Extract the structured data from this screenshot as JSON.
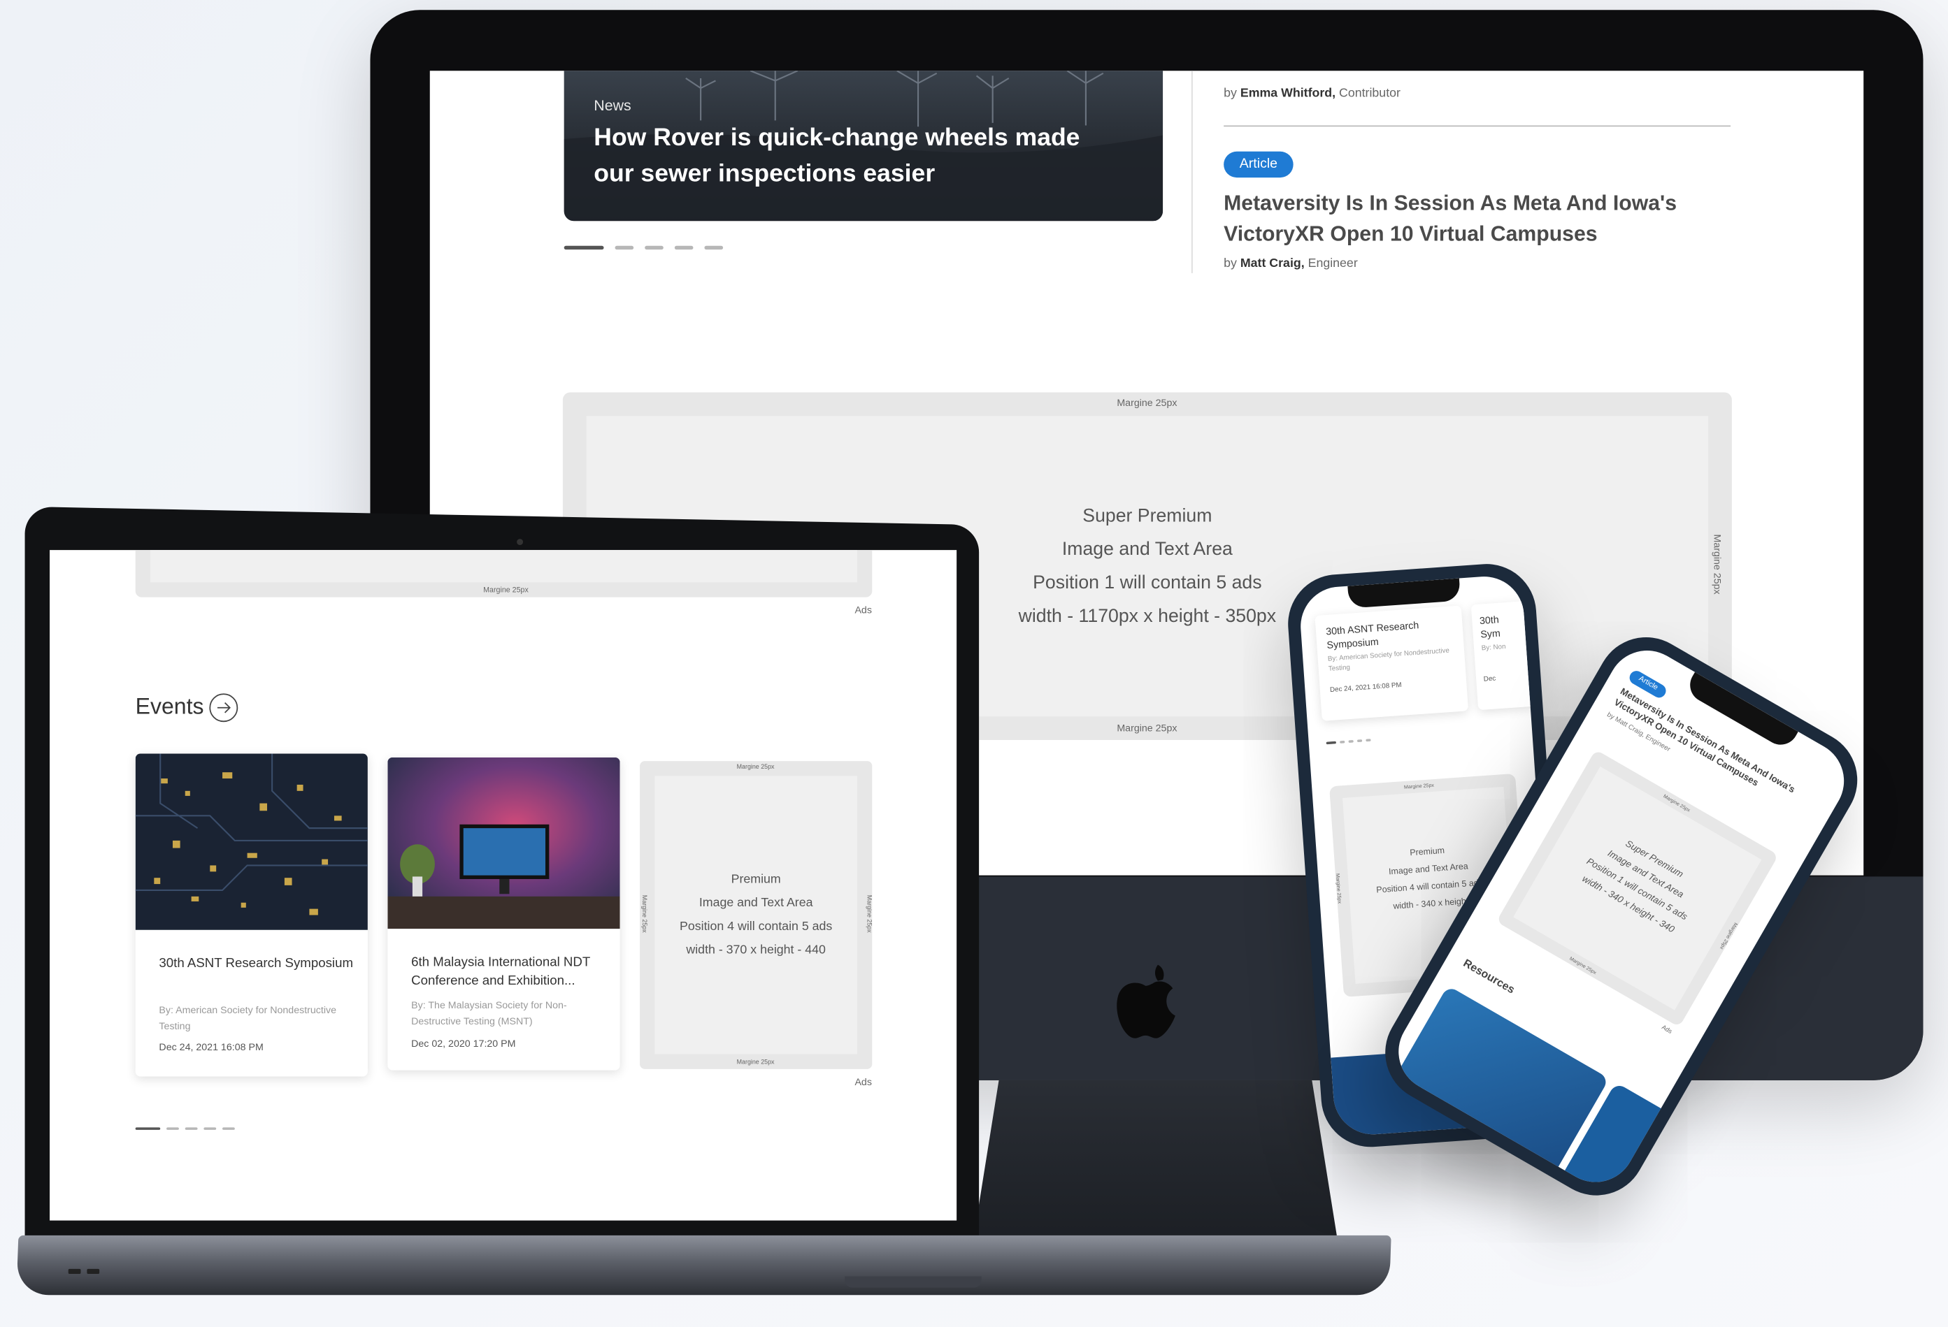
{
  "desktop": {
    "hero": {
      "category": "News",
      "title": "How Rover is quick-change wheels made our sewer inspections easier"
    },
    "byline_top": {
      "prefix": "by",
      "author": "Emma Whitford,",
      "role": "Contributor"
    },
    "article": {
      "badge": "Article",
      "title": "Metaversity Is In Session As Meta And Iowa's VictoryXR Open 10 Virtual Campuses",
      "byline_prefix": "by",
      "author": "Matt Craig,",
      "role": "Engineer"
    },
    "ad": {
      "line1": "Super Premium",
      "line2": "Image and Text Area",
      "line3": "Position 1 will contain 5 ads",
      "line4": "width - 1170px x height - 350px",
      "margin_top": "Margine 25px",
      "margin_bottom": "Margine 25px",
      "margin_right": "Margine 25px"
    }
  },
  "laptop": {
    "top_margin_label": "Margine 25px",
    "ads_label": "Ads",
    "section_title": "Events",
    "cards": [
      {
        "title": "30th ASNT Research Symposium",
        "by": "By: American Society for Nondestructive Testing",
        "date": "Dec 24, 2021 16:08 PM"
      },
      {
        "title": "6th Malaysia International NDT Conference and Exhibition...",
        "by": "By: The Malaysian Society for Non-Destructive Testing (MSNT)",
        "date": "Dec 02, 2020 17:20 PM"
      }
    ],
    "ad": {
      "line1": "Premium",
      "line2": "Image and Text Area",
      "line3": "Position 4 will contain 5 ads",
      "line4": "width - 370 x height - 440",
      "margin_top": "Margine 25px",
      "margin_bottom": "Margine 25px",
      "margin_left": "Margine 25px",
      "margin_right": "Margine 25px"
    },
    "ads_label_2": "Ads"
  },
  "phone1": {
    "card_title": "30th ASNT Research Symposium",
    "card_title_2": "30th Sym",
    "card_by": "By: American Society for Nondestructive Testing",
    "card_by_2": "By: Non",
    "card_date": "Dec 24, 2021 16:08 PM",
    "card_date_2": "Dec",
    "ad_line1": "Premium",
    "ad_line2": "Image and Text Area",
    "ad_line3": "Position 4 will contain 5 ads",
    "ad_line4": "width - 340 x height",
    "margin_top": "Margine 25px",
    "margin_side": "Margine 25px"
  },
  "phone2": {
    "badge": "Article",
    "title": "Metaversity Is In Session As Meta And Iowa's VictoryXR Open 10 Virtual Campuses",
    "byline": "by Matt Craig, Engineer",
    "ad_line1": "Super Premium",
    "ad_line2": "Image and Text Area",
    "ad_line3": "Position 1 will contain 5 ads",
    "ad_line4": "width - 340 x height - 340",
    "margin_top": "Margine 25px",
    "margin_bottom": "Margine 25px",
    "margin_side": "Margine 25px",
    "ads_label": "Ads",
    "section_title": "Resources"
  }
}
